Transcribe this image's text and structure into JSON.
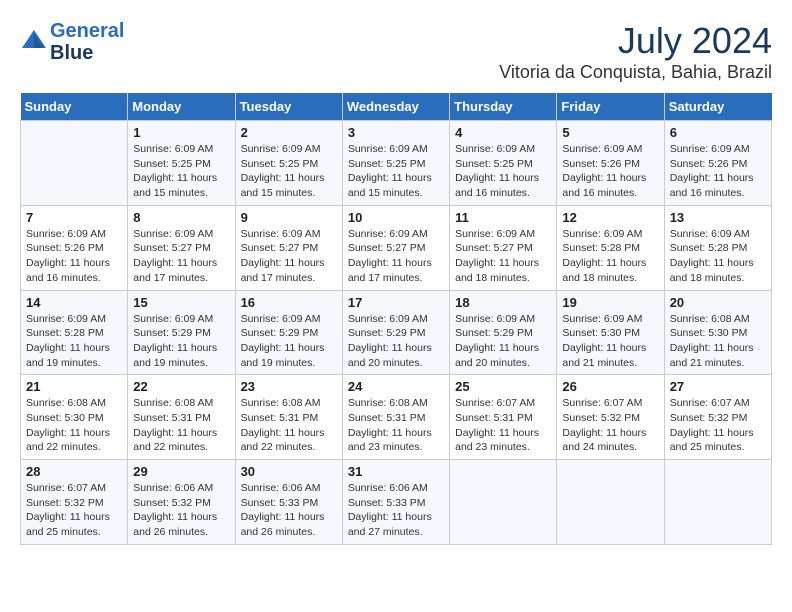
{
  "header": {
    "logo_line1": "General",
    "logo_line2": "Blue",
    "month_year": "July 2024",
    "location": "Vitoria da Conquista, Bahia, Brazil"
  },
  "weekdays": [
    "Sunday",
    "Monday",
    "Tuesday",
    "Wednesday",
    "Thursday",
    "Friday",
    "Saturday"
  ],
  "weeks": [
    [
      {
        "day": "",
        "sunrise": "",
        "sunset": "",
        "daylight": ""
      },
      {
        "day": "1",
        "sunrise": "6:09 AM",
        "sunset": "5:25 PM",
        "daylight": "11 hours and 15 minutes."
      },
      {
        "day": "2",
        "sunrise": "6:09 AM",
        "sunset": "5:25 PM",
        "daylight": "11 hours and 15 minutes."
      },
      {
        "day": "3",
        "sunrise": "6:09 AM",
        "sunset": "5:25 PM",
        "daylight": "11 hours and 15 minutes."
      },
      {
        "day": "4",
        "sunrise": "6:09 AM",
        "sunset": "5:25 PM",
        "daylight": "11 hours and 16 minutes."
      },
      {
        "day": "5",
        "sunrise": "6:09 AM",
        "sunset": "5:26 PM",
        "daylight": "11 hours and 16 minutes."
      },
      {
        "day": "6",
        "sunrise": "6:09 AM",
        "sunset": "5:26 PM",
        "daylight": "11 hours and 16 minutes."
      }
    ],
    [
      {
        "day": "7",
        "sunrise": "6:09 AM",
        "sunset": "5:26 PM",
        "daylight": "11 hours and 16 minutes."
      },
      {
        "day": "8",
        "sunrise": "6:09 AM",
        "sunset": "5:27 PM",
        "daylight": "11 hours and 17 minutes."
      },
      {
        "day": "9",
        "sunrise": "6:09 AM",
        "sunset": "5:27 PM",
        "daylight": "11 hours and 17 minutes."
      },
      {
        "day": "10",
        "sunrise": "6:09 AM",
        "sunset": "5:27 PM",
        "daylight": "11 hours and 17 minutes."
      },
      {
        "day": "11",
        "sunrise": "6:09 AM",
        "sunset": "5:27 PM",
        "daylight": "11 hours and 18 minutes."
      },
      {
        "day": "12",
        "sunrise": "6:09 AM",
        "sunset": "5:28 PM",
        "daylight": "11 hours and 18 minutes."
      },
      {
        "day": "13",
        "sunrise": "6:09 AM",
        "sunset": "5:28 PM",
        "daylight": "11 hours and 18 minutes."
      }
    ],
    [
      {
        "day": "14",
        "sunrise": "6:09 AM",
        "sunset": "5:28 PM",
        "daylight": "11 hours and 19 minutes."
      },
      {
        "day": "15",
        "sunrise": "6:09 AM",
        "sunset": "5:29 PM",
        "daylight": "11 hours and 19 minutes."
      },
      {
        "day": "16",
        "sunrise": "6:09 AM",
        "sunset": "5:29 PM",
        "daylight": "11 hours and 19 minutes."
      },
      {
        "day": "17",
        "sunrise": "6:09 AM",
        "sunset": "5:29 PM",
        "daylight": "11 hours and 20 minutes."
      },
      {
        "day": "18",
        "sunrise": "6:09 AM",
        "sunset": "5:29 PM",
        "daylight": "11 hours and 20 minutes."
      },
      {
        "day": "19",
        "sunrise": "6:09 AM",
        "sunset": "5:30 PM",
        "daylight": "11 hours and 21 minutes."
      },
      {
        "day": "20",
        "sunrise": "6:08 AM",
        "sunset": "5:30 PM",
        "daylight": "11 hours and 21 minutes."
      }
    ],
    [
      {
        "day": "21",
        "sunrise": "6:08 AM",
        "sunset": "5:30 PM",
        "daylight": "11 hours and 22 minutes."
      },
      {
        "day": "22",
        "sunrise": "6:08 AM",
        "sunset": "5:31 PM",
        "daylight": "11 hours and 22 minutes."
      },
      {
        "day": "23",
        "sunrise": "6:08 AM",
        "sunset": "5:31 PM",
        "daylight": "11 hours and 22 minutes."
      },
      {
        "day": "24",
        "sunrise": "6:08 AM",
        "sunset": "5:31 PM",
        "daylight": "11 hours and 23 minutes."
      },
      {
        "day": "25",
        "sunrise": "6:07 AM",
        "sunset": "5:31 PM",
        "daylight": "11 hours and 23 minutes."
      },
      {
        "day": "26",
        "sunrise": "6:07 AM",
        "sunset": "5:32 PM",
        "daylight": "11 hours and 24 minutes."
      },
      {
        "day": "27",
        "sunrise": "6:07 AM",
        "sunset": "5:32 PM",
        "daylight": "11 hours and 25 minutes."
      }
    ],
    [
      {
        "day": "28",
        "sunrise": "6:07 AM",
        "sunset": "5:32 PM",
        "daylight": "11 hours and 25 minutes."
      },
      {
        "day": "29",
        "sunrise": "6:06 AM",
        "sunset": "5:32 PM",
        "daylight": "11 hours and 26 minutes."
      },
      {
        "day": "30",
        "sunrise": "6:06 AM",
        "sunset": "5:33 PM",
        "daylight": "11 hours and 26 minutes."
      },
      {
        "day": "31",
        "sunrise": "6:06 AM",
        "sunset": "5:33 PM",
        "daylight": "11 hours and 27 minutes."
      },
      {
        "day": "",
        "sunrise": "",
        "sunset": "",
        "daylight": ""
      },
      {
        "day": "",
        "sunrise": "",
        "sunset": "",
        "daylight": ""
      },
      {
        "day": "",
        "sunrise": "",
        "sunset": "",
        "daylight": ""
      }
    ]
  ]
}
